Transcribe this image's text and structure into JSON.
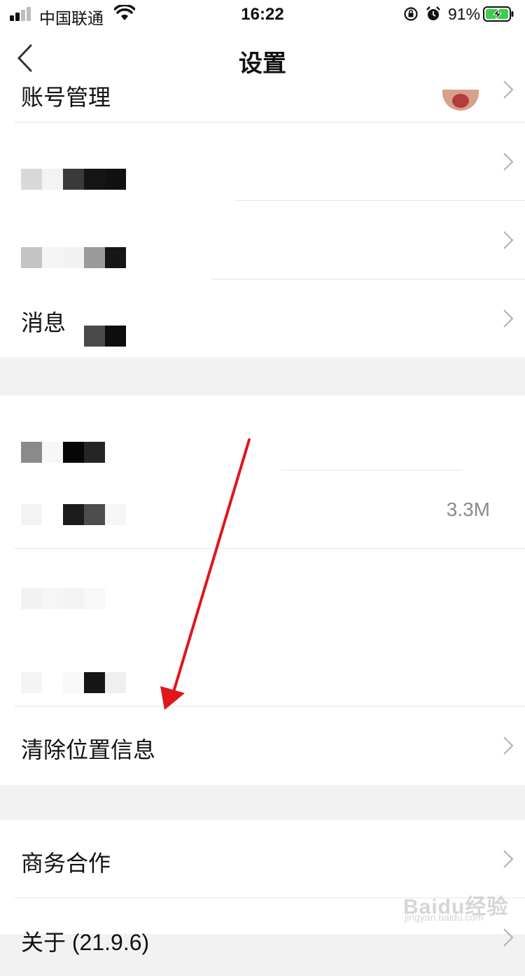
{
  "status_bar": {
    "carrier": "中国联通",
    "time": "16:22",
    "battery": "91%"
  },
  "nav": {
    "title": "设置"
  },
  "section1": {
    "rows": [
      {
        "label": "账号管理"
      },
      {
        "label": ""
      },
      {
        "label": ""
      },
      {
        "label": "消息设置"
      }
    ]
  },
  "section2": {
    "rows": [
      {
        "label": ""
      },
      {
        "label": "",
        "value": "3.3M"
      },
      {
        "label": ""
      },
      {
        "label": ""
      },
      {
        "label": "清除位置信息"
      }
    ]
  },
  "section3": {
    "rows": [
      {
        "label": "商务合作"
      },
      {
        "label": "关于 (21.9.6)"
      }
    ]
  },
  "annotation": {
    "color": "#e0161b"
  },
  "watermark": {
    "brand": "Baidu经验",
    "url": "jingyan.baidu.com"
  }
}
